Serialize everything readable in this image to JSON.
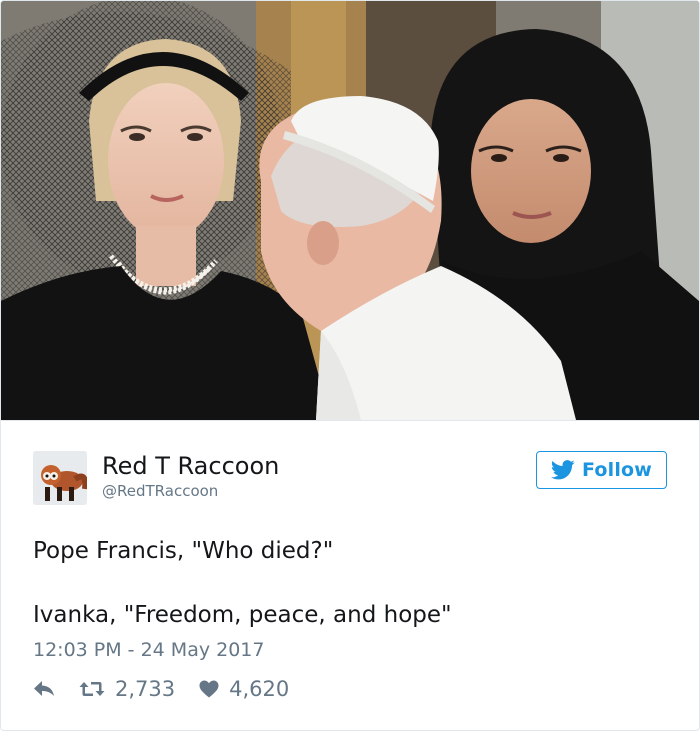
{
  "tweet": {
    "display_name": "Red T Raccoon",
    "screen_name": "@RedTRaccoon",
    "follow_label": "Follow",
    "text": "Pope Francis, \"Who died?\"\n\nIvanka, \"Freedom, peace, and hope\"",
    "timestamp": "12:03 PM - 24 May 2017",
    "retweet_count": "2,733",
    "like_count": "4,620"
  },
  "icons": {
    "follow": "twitter-bird-icon",
    "reply": "reply-icon",
    "retweet": "retweet-icon",
    "like": "heart-icon"
  },
  "colors": {
    "accent": "#1b95e0",
    "text": "#14171a",
    "muted": "#657786",
    "border": "#e1e8ed"
  }
}
